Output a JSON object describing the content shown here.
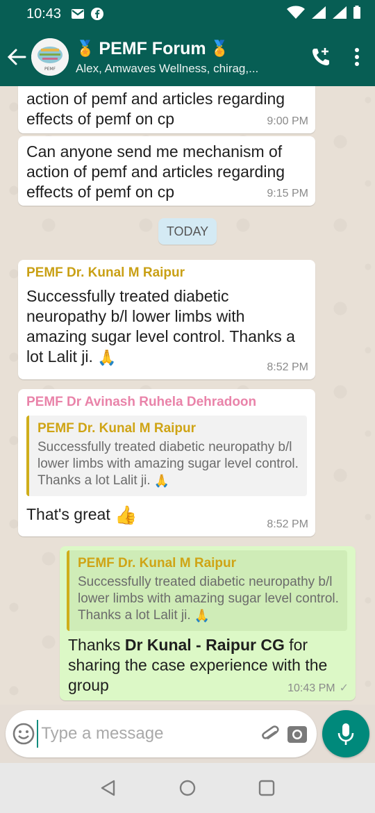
{
  "status_bar": {
    "time": "10:43"
  },
  "header": {
    "title": "PEMF Forum",
    "subtitle": "Alex, Amwaves Wellness, chirag,...",
    "medal_icon": "🏅"
  },
  "chat": {
    "day_label": "TODAY",
    "messages": [
      {
        "text": "action of pemf and articles regarding effects of pemf on cp",
        "time": "9:00 PM"
      },
      {
        "text": "Can anyone send me mechanism of action of pemf and articles regarding effects of pemf on cp",
        "time": "9:15 PM"
      },
      {
        "sender": "PEMF Dr. Kunal M Raipur",
        "sender_color": "#c9a015",
        "text": "Successfully treated diabetic neuropathy b/l lower limbs with amazing sugar level control. Thanks a lot Lalit ji.",
        "emoji": "🙏",
        "time": "8:52 PM"
      },
      {
        "sender": "PEMF Dr Avinash Ruhela Dehradoon",
        "sender_color": "#e983a9",
        "quote_sender": "PEMF Dr. Kunal M Raipur",
        "quote_text": "Successfully treated diabetic neuropathy b/l lower limbs with amazing sugar level control. Thanks a lot Lalit ji.",
        "quote_emoji": "🙏",
        "text": "That's great",
        "emoji": "👍",
        "time": "8:52 PM"
      },
      {
        "quote_sender": "PEMF Dr. Kunal M Raipur",
        "quote_text": "Successfully treated diabetic neuropathy b/l lower limbs with amazing sugar level control. Thanks a lot Lalit ji.",
        "quote_emoji": "🙏",
        "text_pre": "Thanks ",
        "text_bold": "Dr Kunal - Raipur CG",
        "text_post": " for sharing the case experience with the group",
        "time": "10:43 PM",
        "tick": "✓"
      }
    ]
  },
  "composer": {
    "placeholder": "Type a message"
  },
  "colors": {
    "header": "#075e54",
    "outgoing": "#dcf8c6",
    "accent": "#00897b"
  }
}
